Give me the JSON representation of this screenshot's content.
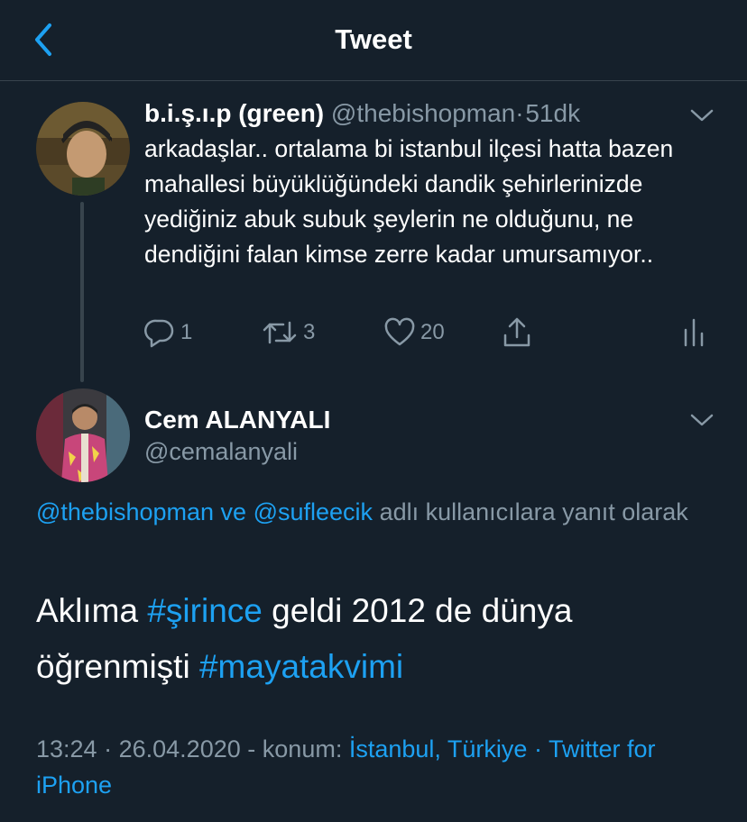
{
  "header": {
    "title": "Tweet"
  },
  "tweet1": {
    "display_name": "b.i.ş.ı.p (green)",
    "handle": "@thebishopman",
    "separator": "·",
    "time_ago": "51dk",
    "text": "arkadaşlar.. ortalama bi istanbul ilçesi hatta bazen mahallesi büyüklüğündeki dandik şehirlerinizde yediğiniz abuk subuk şeylerin ne olduğunu, ne dendiğini falan kimse zerre kadar umursamıyor..",
    "replies": "1",
    "retweets": "3",
    "likes": "20"
  },
  "tweet2": {
    "display_name": "Cem ALANYALI",
    "handle": "@cemalanyali",
    "reply_mention_1": "@thebishopman",
    "reply_and": "ve",
    "reply_mention_2": "@sufleecik",
    "reply_suffix": "adlı kullanıcılara yanıt olarak",
    "text_1": "Aklıma",
    "hashtag_1": "#şirince",
    "text_2": "geldi 2012 de dünya öğrenmişti",
    "hashtag_2": "#mayatakvimi",
    "time": "13:24",
    "dot": "·",
    "date": "26.04.2020",
    "dash": "-",
    "location_label": "konum:",
    "location": "İstanbul, Türkiye",
    "dot2": "·",
    "source": "Twitter for iPhone"
  },
  "colors": {
    "background": "#15202b",
    "accent": "#1da1f2",
    "muted": "#8899a6",
    "divider": "#38444d"
  },
  "icons": {
    "back": "chevron-left-icon",
    "caret": "chevron-down-icon",
    "reply": "reply-icon",
    "retweet": "retweet-icon",
    "like": "heart-icon",
    "share": "share-icon",
    "analytics": "analytics-icon"
  }
}
